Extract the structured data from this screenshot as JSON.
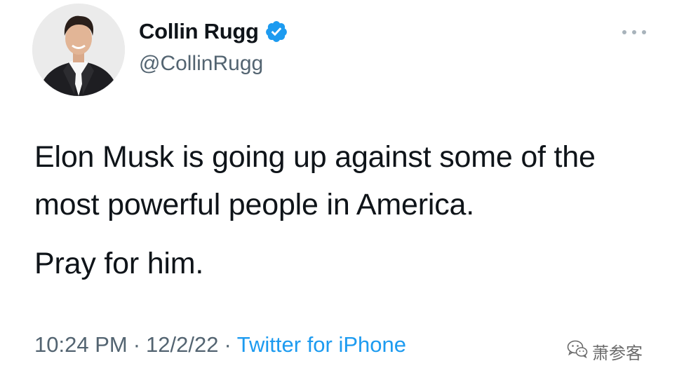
{
  "author": {
    "display_name": "Collin Rugg",
    "handle": "@CollinRugg",
    "verified": true
  },
  "tweet": {
    "paragraphs": [
      "Elon Musk is going up against some of the most powerful people in America.",
      "Pray for him."
    ]
  },
  "meta": {
    "time": "10:24 PM",
    "separator": "·",
    "date": "12/2/22",
    "source": "Twitter for iPhone"
  },
  "watermark": {
    "text": "萧参客",
    "icon": "wechat-icon"
  },
  "icons": {
    "verified": "verified-badge-icon",
    "more": "more-dots-icon"
  },
  "colors": {
    "accent": "#1d9bf0",
    "text": "#0f1419",
    "secondary": "#536471"
  }
}
